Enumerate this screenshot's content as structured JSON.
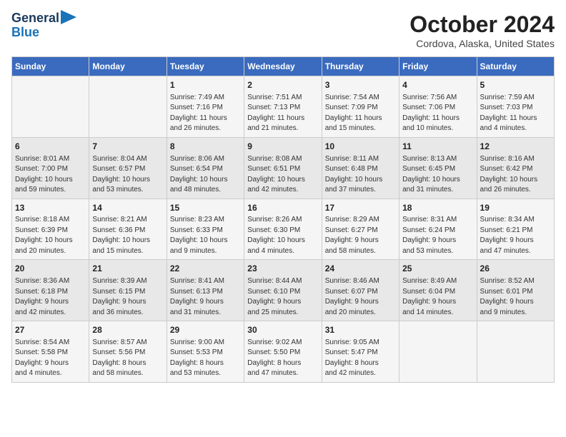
{
  "logo": {
    "line1": "General",
    "line2": "Blue"
  },
  "header": {
    "month": "October 2024",
    "location": "Cordova, Alaska, United States"
  },
  "weekdays": [
    "Sunday",
    "Monday",
    "Tuesday",
    "Wednesday",
    "Thursday",
    "Friday",
    "Saturday"
  ],
  "weeks": [
    [
      {
        "day": "",
        "info": ""
      },
      {
        "day": "",
        "info": ""
      },
      {
        "day": "1",
        "info": "Sunrise: 7:49 AM\nSunset: 7:16 PM\nDaylight: 11 hours\nand 26 minutes."
      },
      {
        "day": "2",
        "info": "Sunrise: 7:51 AM\nSunset: 7:13 PM\nDaylight: 11 hours\nand 21 minutes."
      },
      {
        "day": "3",
        "info": "Sunrise: 7:54 AM\nSunset: 7:09 PM\nDaylight: 11 hours\nand 15 minutes."
      },
      {
        "day": "4",
        "info": "Sunrise: 7:56 AM\nSunset: 7:06 PM\nDaylight: 11 hours\nand 10 minutes."
      },
      {
        "day": "5",
        "info": "Sunrise: 7:59 AM\nSunset: 7:03 PM\nDaylight: 11 hours\nand 4 minutes."
      }
    ],
    [
      {
        "day": "6",
        "info": "Sunrise: 8:01 AM\nSunset: 7:00 PM\nDaylight: 10 hours\nand 59 minutes."
      },
      {
        "day": "7",
        "info": "Sunrise: 8:04 AM\nSunset: 6:57 PM\nDaylight: 10 hours\nand 53 minutes."
      },
      {
        "day": "8",
        "info": "Sunrise: 8:06 AM\nSunset: 6:54 PM\nDaylight: 10 hours\nand 48 minutes."
      },
      {
        "day": "9",
        "info": "Sunrise: 8:08 AM\nSunset: 6:51 PM\nDaylight: 10 hours\nand 42 minutes."
      },
      {
        "day": "10",
        "info": "Sunrise: 8:11 AM\nSunset: 6:48 PM\nDaylight: 10 hours\nand 37 minutes."
      },
      {
        "day": "11",
        "info": "Sunrise: 8:13 AM\nSunset: 6:45 PM\nDaylight: 10 hours\nand 31 minutes."
      },
      {
        "day": "12",
        "info": "Sunrise: 8:16 AM\nSunset: 6:42 PM\nDaylight: 10 hours\nand 26 minutes."
      }
    ],
    [
      {
        "day": "13",
        "info": "Sunrise: 8:18 AM\nSunset: 6:39 PM\nDaylight: 10 hours\nand 20 minutes."
      },
      {
        "day": "14",
        "info": "Sunrise: 8:21 AM\nSunset: 6:36 PM\nDaylight: 10 hours\nand 15 minutes."
      },
      {
        "day": "15",
        "info": "Sunrise: 8:23 AM\nSunset: 6:33 PM\nDaylight: 10 hours\nand 9 minutes."
      },
      {
        "day": "16",
        "info": "Sunrise: 8:26 AM\nSunset: 6:30 PM\nDaylight: 10 hours\nand 4 minutes."
      },
      {
        "day": "17",
        "info": "Sunrise: 8:29 AM\nSunset: 6:27 PM\nDaylight: 9 hours\nand 58 minutes."
      },
      {
        "day": "18",
        "info": "Sunrise: 8:31 AM\nSunset: 6:24 PM\nDaylight: 9 hours\nand 53 minutes."
      },
      {
        "day": "19",
        "info": "Sunrise: 8:34 AM\nSunset: 6:21 PM\nDaylight: 9 hours\nand 47 minutes."
      }
    ],
    [
      {
        "day": "20",
        "info": "Sunrise: 8:36 AM\nSunset: 6:18 PM\nDaylight: 9 hours\nand 42 minutes."
      },
      {
        "day": "21",
        "info": "Sunrise: 8:39 AM\nSunset: 6:15 PM\nDaylight: 9 hours\nand 36 minutes."
      },
      {
        "day": "22",
        "info": "Sunrise: 8:41 AM\nSunset: 6:13 PM\nDaylight: 9 hours\nand 31 minutes."
      },
      {
        "day": "23",
        "info": "Sunrise: 8:44 AM\nSunset: 6:10 PM\nDaylight: 9 hours\nand 25 minutes."
      },
      {
        "day": "24",
        "info": "Sunrise: 8:46 AM\nSunset: 6:07 PM\nDaylight: 9 hours\nand 20 minutes."
      },
      {
        "day": "25",
        "info": "Sunrise: 8:49 AM\nSunset: 6:04 PM\nDaylight: 9 hours\nand 14 minutes."
      },
      {
        "day": "26",
        "info": "Sunrise: 8:52 AM\nSunset: 6:01 PM\nDaylight: 9 hours\nand 9 minutes."
      }
    ],
    [
      {
        "day": "27",
        "info": "Sunrise: 8:54 AM\nSunset: 5:58 PM\nDaylight: 9 hours\nand 4 minutes."
      },
      {
        "day": "28",
        "info": "Sunrise: 8:57 AM\nSunset: 5:56 PM\nDaylight: 8 hours\nand 58 minutes."
      },
      {
        "day": "29",
        "info": "Sunrise: 9:00 AM\nSunset: 5:53 PM\nDaylight: 8 hours\nand 53 minutes."
      },
      {
        "day": "30",
        "info": "Sunrise: 9:02 AM\nSunset: 5:50 PM\nDaylight: 8 hours\nand 47 minutes."
      },
      {
        "day": "31",
        "info": "Sunrise: 9:05 AM\nSunset: 5:47 PM\nDaylight: 8 hours\nand 42 minutes."
      },
      {
        "day": "",
        "info": ""
      },
      {
        "day": "",
        "info": ""
      }
    ]
  ]
}
